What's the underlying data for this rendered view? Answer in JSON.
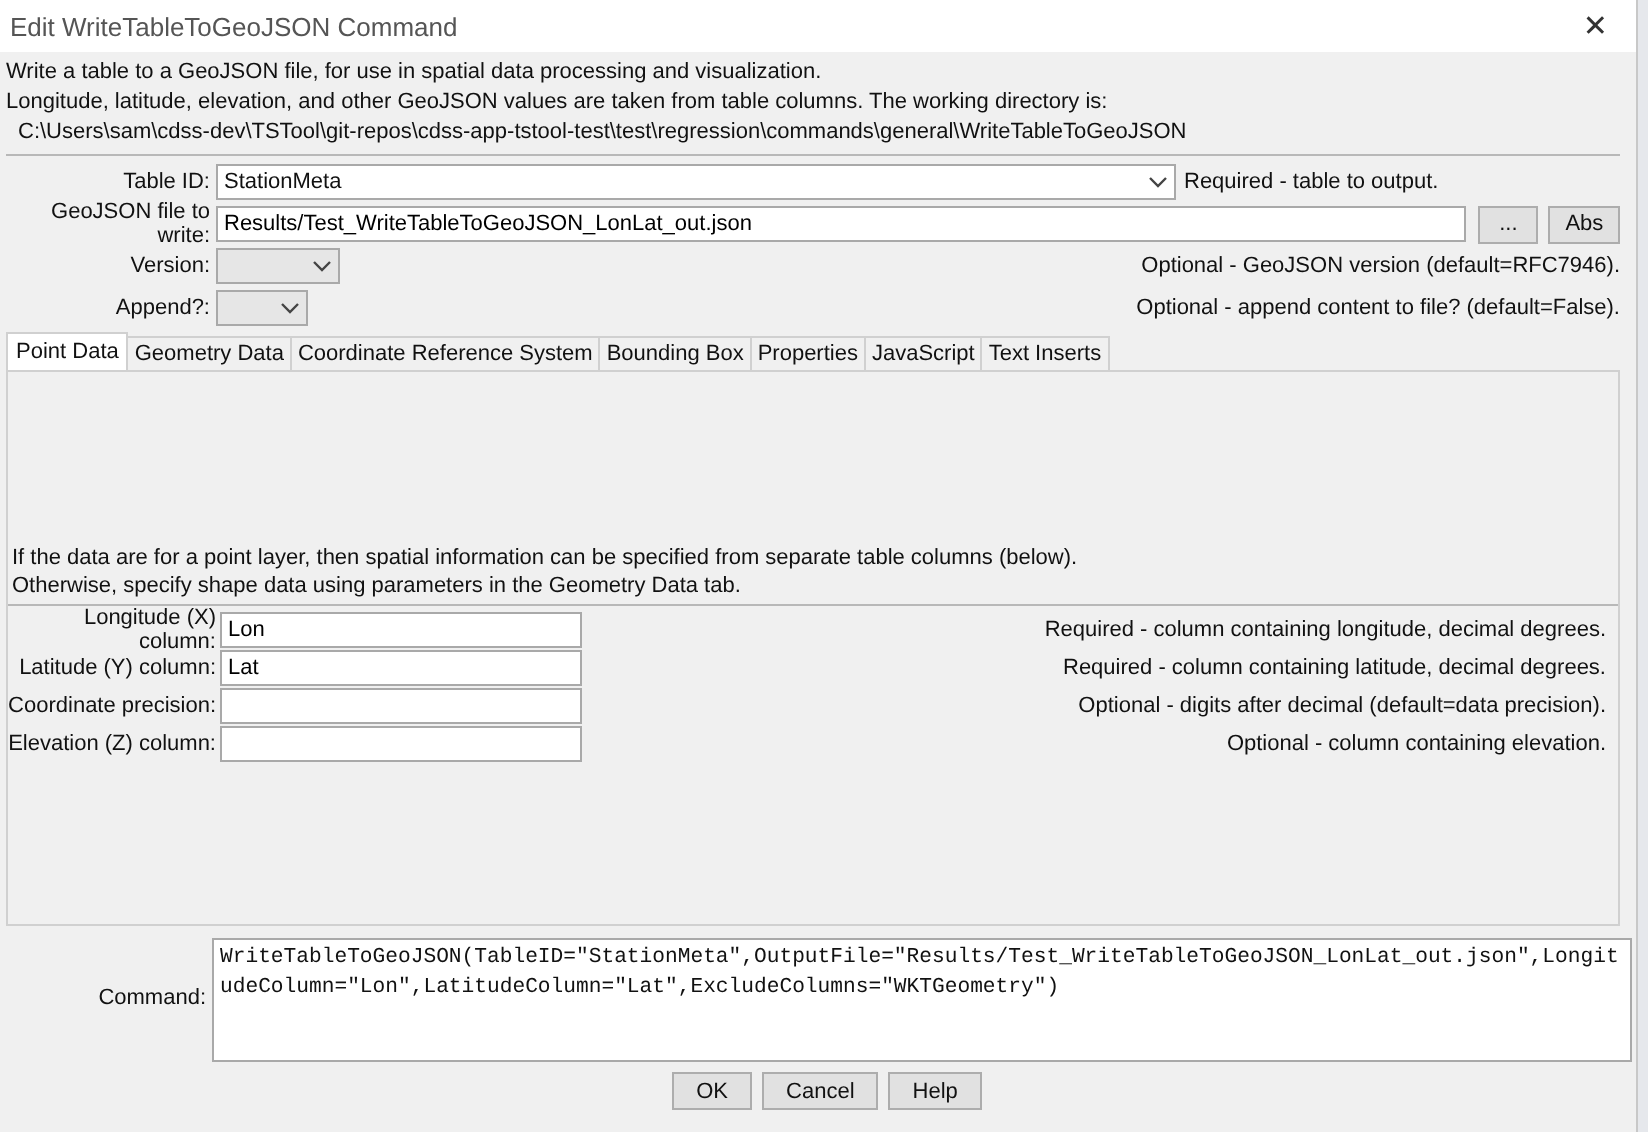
{
  "window": {
    "title": "Edit WriteTableToGeoJSON Command",
    "close": "✕"
  },
  "description": [
    "Write a table to a GeoJSON file, for use in spatial data processing and visualization.",
    "Longitude, latitude, elevation, and other GeoJSON values are taken from table columns.  The working directory is:",
    "C:\\Users\\sam\\cdss-dev\\TSTool\\git-repos\\cdss-app-tstool-test\\test\\regression\\commands\\general\\WriteTableToGeoJSON"
  ],
  "table_id": {
    "label": "Table ID:",
    "value": "StationMeta",
    "note": "Required - table to output."
  },
  "file": {
    "label": "GeoJSON file to write:",
    "value": "Results/Test_WriteTableToGeoJSON_LonLat_out.json",
    "browse": "...",
    "abs": "Abs"
  },
  "version": {
    "label": "Version:",
    "note": "Optional - GeoJSON version (default=RFC7946)."
  },
  "append": {
    "label": "Append?:",
    "note": "Optional - append content to file? (default=False)."
  },
  "tabs": [
    {
      "label": "Point Data",
      "selected": true
    },
    {
      "label": "Geometry Data",
      "selected": false
    },
    {
      "label": "Coordinate Reference System",
      "selected": false
    },
    {
      "label": "Bounding Box",
      "selected": false
    },
    {
      "label": "Properties",
      "selected": false
    },
    {
      "label": "JavaScript",
      "selected": false
    },
    {
      "label": "Text Inserts",
      "selected": false
    }
  ],
  "panel": {
    "info": [
      "If the data are for a point layer, then spatial information can be specified from separate table columns (below).",
      "Otherwise, specify shape data using parameters in the Geometry Data tab."
    ],
    "fields": [
      {
        "label": "Longitude (X) column:",
        "value": "Lon",
        "note": "Required - column containing longitude, decimal degrees."
      },
      {
        "label": "Latitude (Y) column:",
        "value": "Lat",
        "note": "Required - column containing latitude, decimal degrees."
      },
      {
        "label": "Coordinate precision:",
        "note": "Optional - digits after decimal (default=data precision)."
      },
      {
        "label": "Elevation (Z) column:",
        "note": "Optional - column containing elevation."
      }
    ]
  },
  "command": {
    "label": "Command:",
    "value": "WriteTableToGeoJSON(TableID=\"StationMeta\",OutputFile=\"Results/Test_WriteTableToGeoJSON_LonLat_out.json\",LongitudeColumn=\"Lon\",LatitudeColumn=\"Lat\",ExcludeColumns=\"WKTGeometry\")"
  },
  "buttons": [
    "OK",
    "Cancel",
    "Help"
  ]
}
